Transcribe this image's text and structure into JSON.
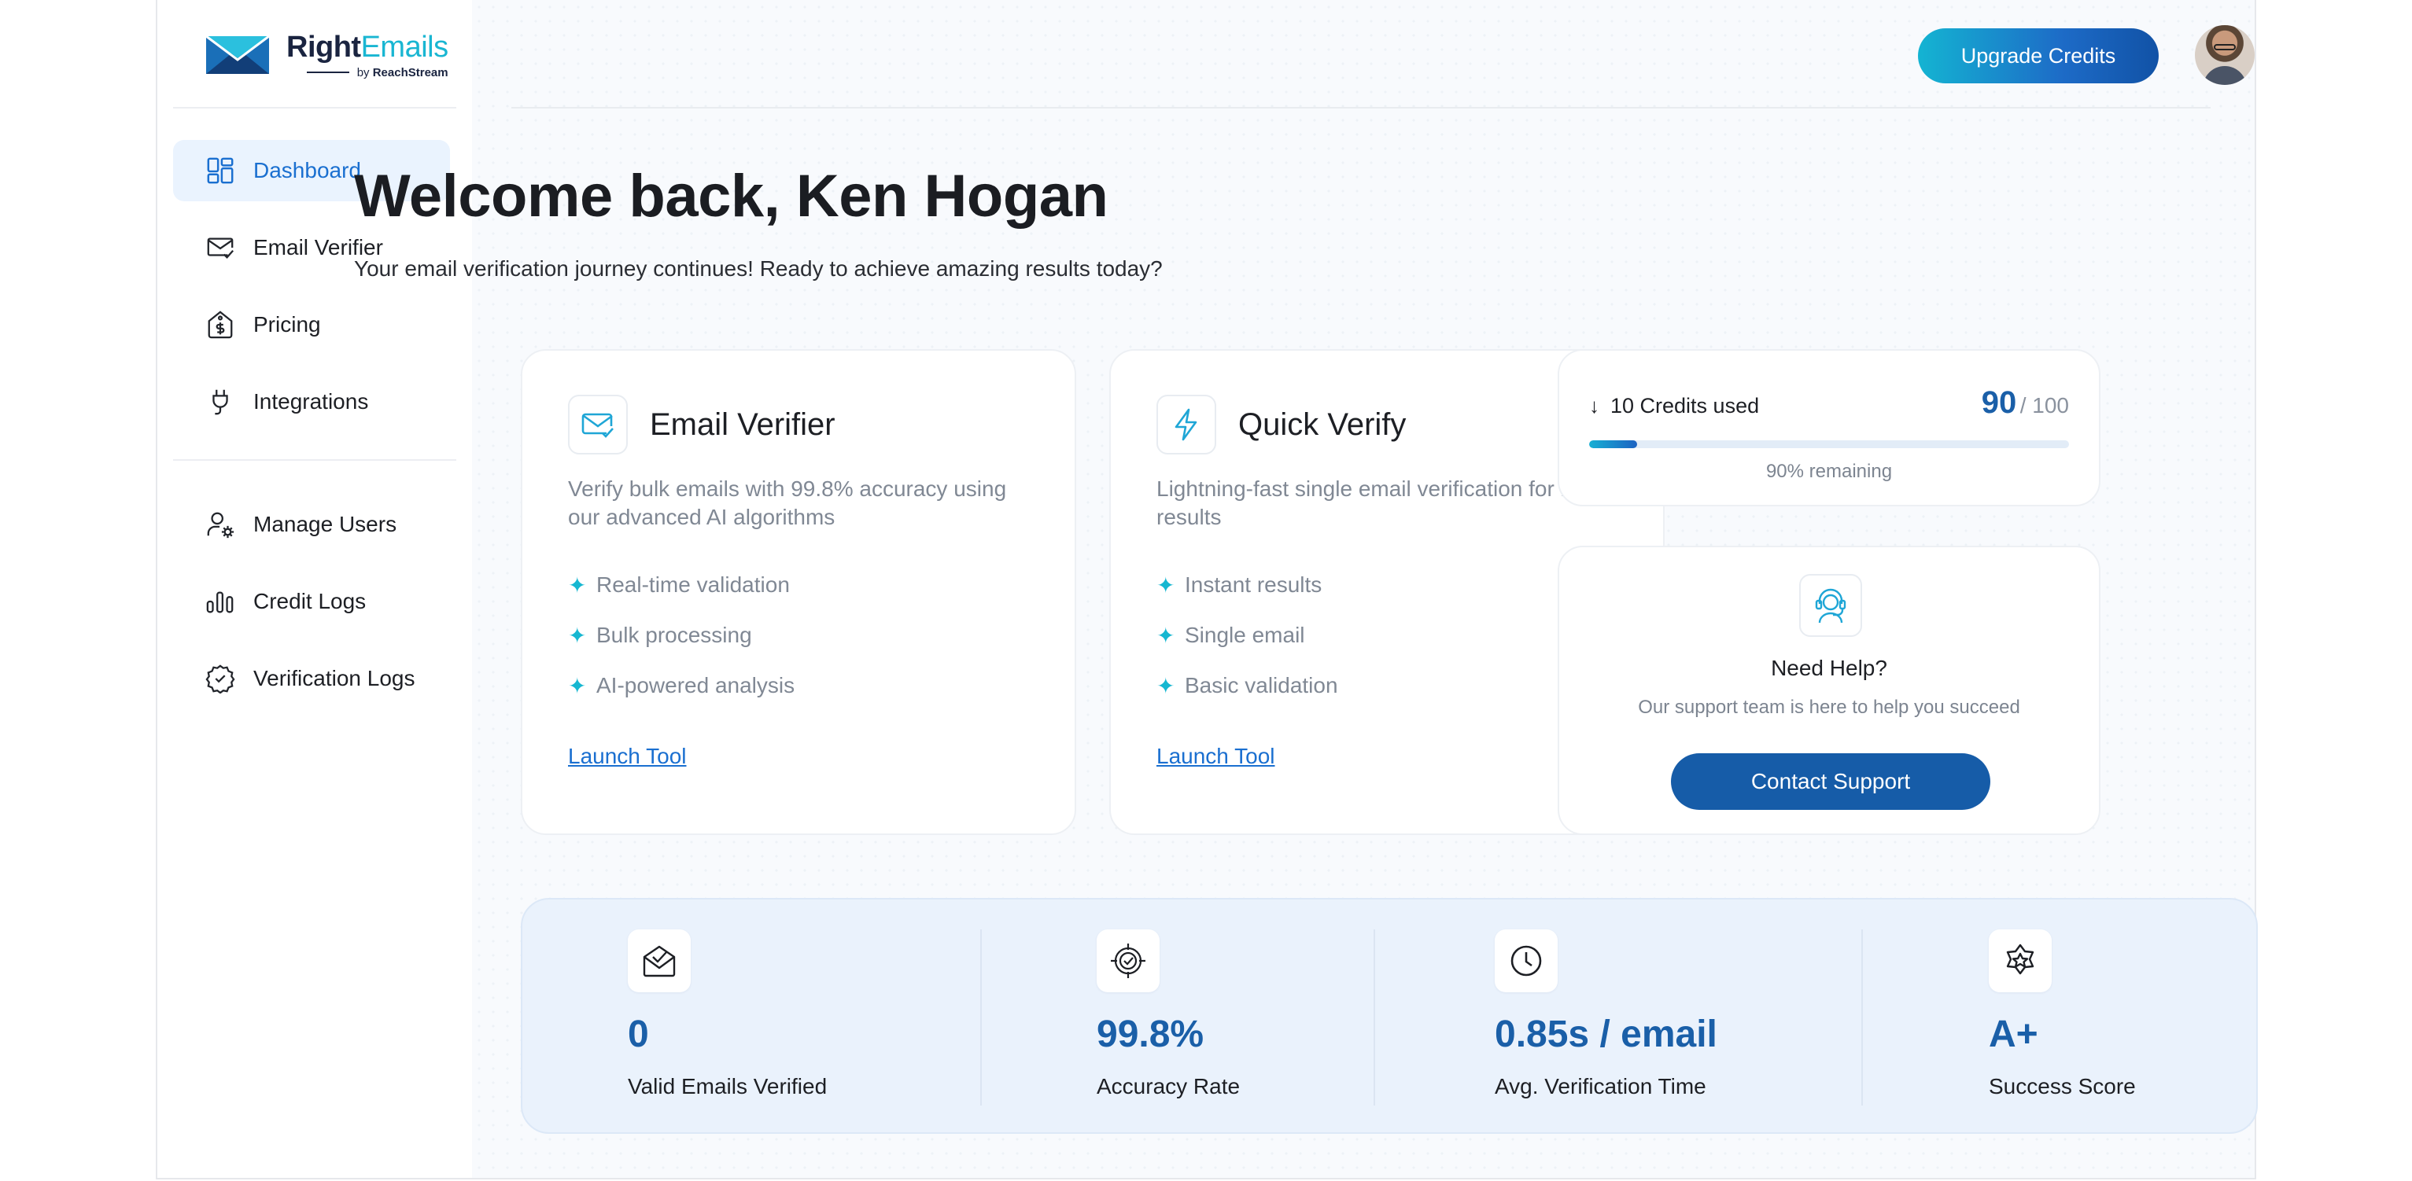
{
  "brand": {
    "name_dark": "Right",
    "name_accent": "Emails",
    "by_prefix": "by",
    "by_name": "ReachStream"
  },
  "sidebar": {
    "items": [
      {
        "label": "Dashboard",
        "icon": "dashboard-icon",
        "active": true
      },
      {
        "label": "Email Verifier",
        "icon": "mail-check-icon"
      },
      {
        "label": "Pricing",
        "icon": "price-tag-icon"
      },
      {
        "label": "Integrations",
        "icon": "plug-icon"
      },
      {
        "label": "Manage Users",
        "icon": "user-gear-icon"
      },
      {
        "label": "Credit Logs",
        "icon": "bar-chart-icon"
      },
      {
        "label": "Verification Logs",
        "icon": "badge-check-icon"
      }
    ]
  },
  "header": {
    "upgrade_label": "Upgrade Credits",
    "avatar": "user-avatar"
  },
  "welcome": {
    "title": "Welcome back, Ken Hogan",
    "subtitle": "Your email verification journey continues! Ready to achieve amazing results today?"
  },
  "tools": [
    {
      "title": "Email Verifier",
      "icon": "mail-check-icon",
      "description": "Verify bulk emails with 99.8% accuracy using our advanced AI algorithms",
      "features": [
        "Real-time validation",
        "Bulk processing",
        "AI-powered analysis"
      ],
      "link": "Launch Tool"
    },
    {
      "title": "Quick Verify",
      "icon": "lightning-icon",
      "description": "Lightning-fast single email verification for instant results",
      "features": [
        "Instant results",
        "Single email",
        "Basic validation"
      ],
      "link": "Launch Tool"
    }
  ],
  "credits": {
    "used_label": "10 Credits used",
    "available": "90",
    "total": "/ 100",
    "remaining_label": "90% remaining",
    "used_fraction": 0.1,
    "icon": "arrow-down-icon"
  },
  "help": {
    "title": "Need Help?",
    "subtitle": "Our support team is here to help you succeed",
    "button": "Contact Support",
    "icon": "headset-icon"
  },
  "stats": [
    {
      "value": "0",
      "label": "Valid Emails Verified",
      "icon": "mail-open-check-icon"
    },
    {
      "value": "99.8%",
      "label": "Accuracy Rate",
      "icon": "target-check-icon"
    },
    {
      "value": "0.85s / email",
      "label": "Avg. Verification Time",
      "icon": "clock-icon"
    },
    {
      "value": "A+",
      "label": "Success Score",
      "icon": "star-badge-icon"
    }
  ],
  "colors": {
    "accent": "#1a6fd0",
    "brand_teal": "#19b6d2",
    "stat_value": "#1a5fa8",
    "support_button": "#165ca8"
  }
}
